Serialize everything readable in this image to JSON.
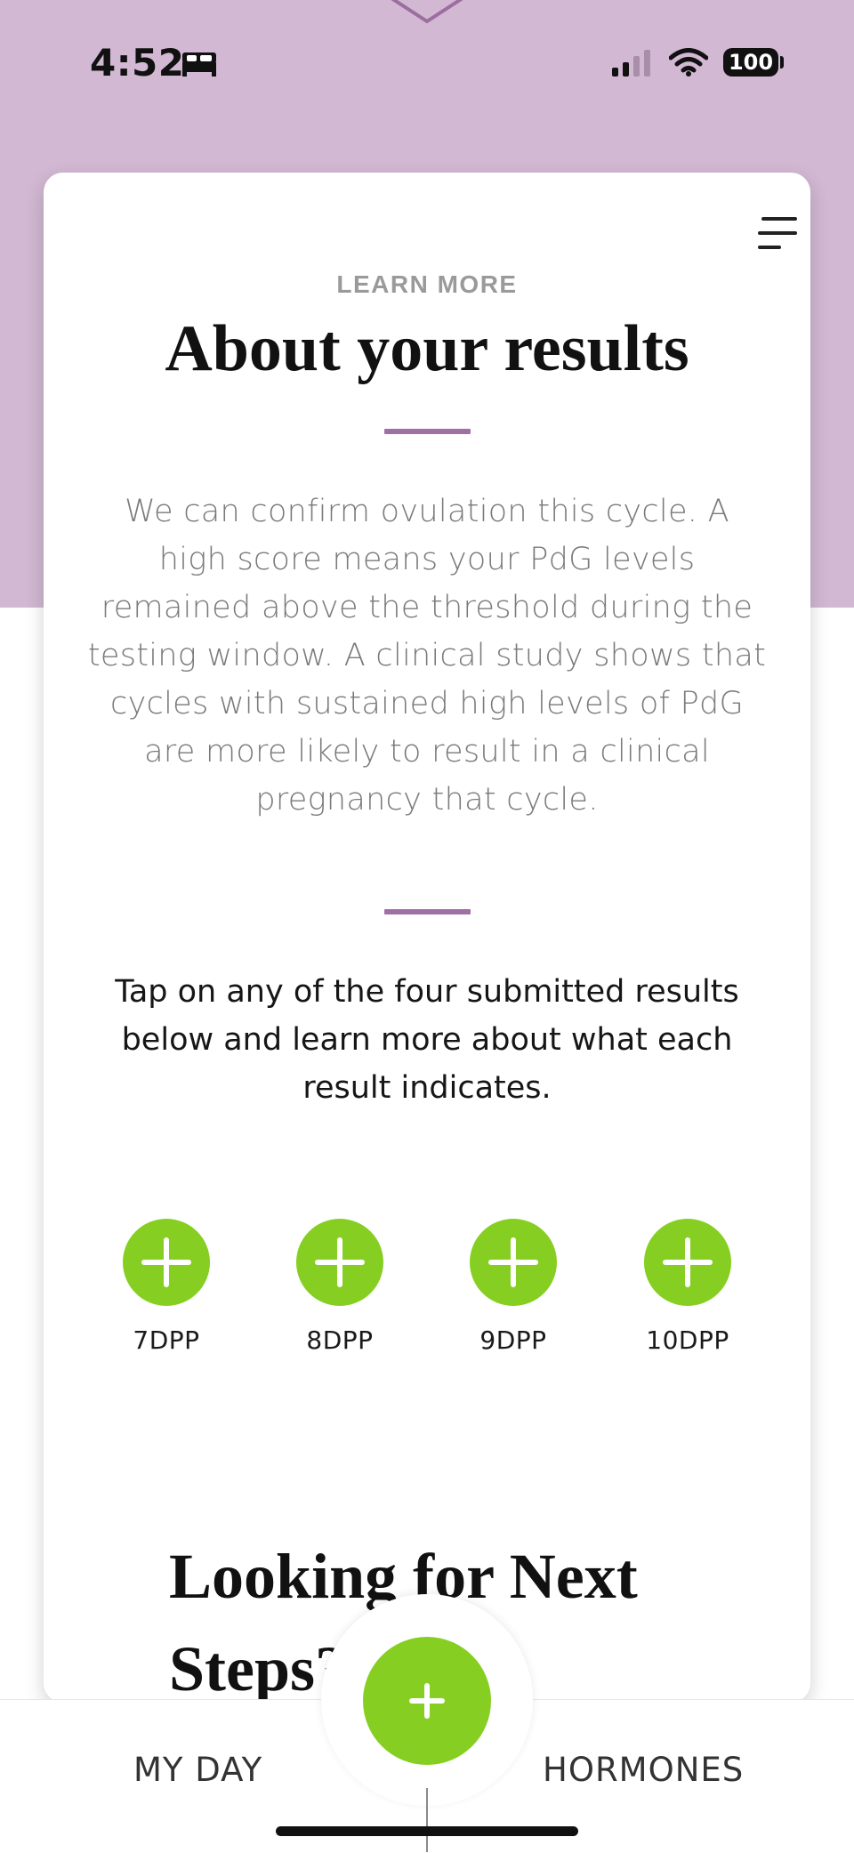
{
  "status_bar": {
    "time": "4:52",
    "sleep_icon": "bed-icon",
    "battery_level": "100"
  },
  "card": {
    "eyebrow": "LEARN MORE",
    "title": "About your results",
    "body_lines": [
      "We can confirm ovulation this cycle. A",
      "high score means your PdG levels",
      "remained above the threshold during the",
      "testing window. A clinical study shows that",
      "cycles with sustained high levels of PdG",
      "are more likely to result in a clinical",
      "pregnancy that cycle."
    ],
    "tap_lines": [
      "Tap on any of the four submitted results",
      "below and learn more about what each",
      "result indicates."
    ],
    "results": [
      "7DPP",
      "8DPP",
      "9DPP",
      "10DPP"
    ],
    "next_steps_lines": [
      "Looking for Next",
      "Steps?"
    ]
  },
  "tabs": {
    "left": "MY DAY",
    "right": "HORMONES"
  },
  "colors": {
    "hero": "#d2b8d2",
    "accent_rule": "#a06fa6",
    "green": "#86cf22"
  }
}
